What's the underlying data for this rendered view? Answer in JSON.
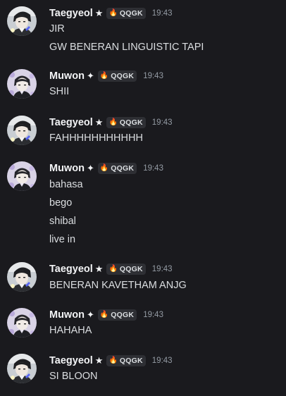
{
  "colors": {
    "background": "#1a1a1e",
    "username": "#f2f3f5",
    "message_text": "#dbdee1",
    "timestamp": "#949ba4",
    "tag_background": "#2e2f34"
  },
  "messages": [
    {
      "author": "Taegyeol",
      "author_badge": "★",
      "tag_icon": "fire-icon",
      "tag_glyph": "🔥",
      "tag": "QQGK",
      "time": "19:43",
      "lines": [
        "JIR",
        "GW BENERAN LINGUISTIC TAPI"
      ]
    },
    {
      "author": "Muwon",
      "author_badge": "✦",
      "tag_icon": "fire-icon",
      "tag_glyph": "🔥",
      "tag": "QQGK",
      "time": "19:43",
      "lines": [
        "SHII"
      ]
    },
    {
      "author": "Taegyeol",
      "author_badge": "★",
      "tag_icon": "fire-icon",
      "tag_glyph": "🔥",
      "tag": "QQGK",
      "time": "19:43",
      "lines": [
        "FAHHHHHHHHHHH"
      ]
    },
    {
      "author": "Muwon",
      "author_badge": "✦",
      "tag_icon": "fire-icon",
      "tag_glyph": "🔥",
      "tag": "QQGK",
      "time": "19:43",
      "lines": [
        "bahasa",
        "bego",
        "shibal",
        "live in"
      ]
    },
    {
      "author": "Taegyeol",
      "author_badge": "★",
      "tag_icon": "fire-icon",
      "tag_glyph": "🔥",
      "tag": "QQGK",
      "time": "19:43",
      "lines": [
        "BENERAN KAVETHAM ANJG"
      ]
    },
    {
      "author": "Muwon",
      "author_badge": "✦",
      "tag_icon": "fire-icon",
      "tag_glyph": "🔥",
      "tag": "QQGK",
      "time": "19:43",
      "lines": [
        "HAHAHA"
      ]
    },
    {
      "author": "Taegyeol",
      "author_badge": "★",
      "tag_icon": "fire-icon",
      "tag_glyph": "🔥",
      "tag": "QQGK",
      "time": "19:43",
      "lines": [
        "SI BLOON"
      ]
    }
  ]
}
